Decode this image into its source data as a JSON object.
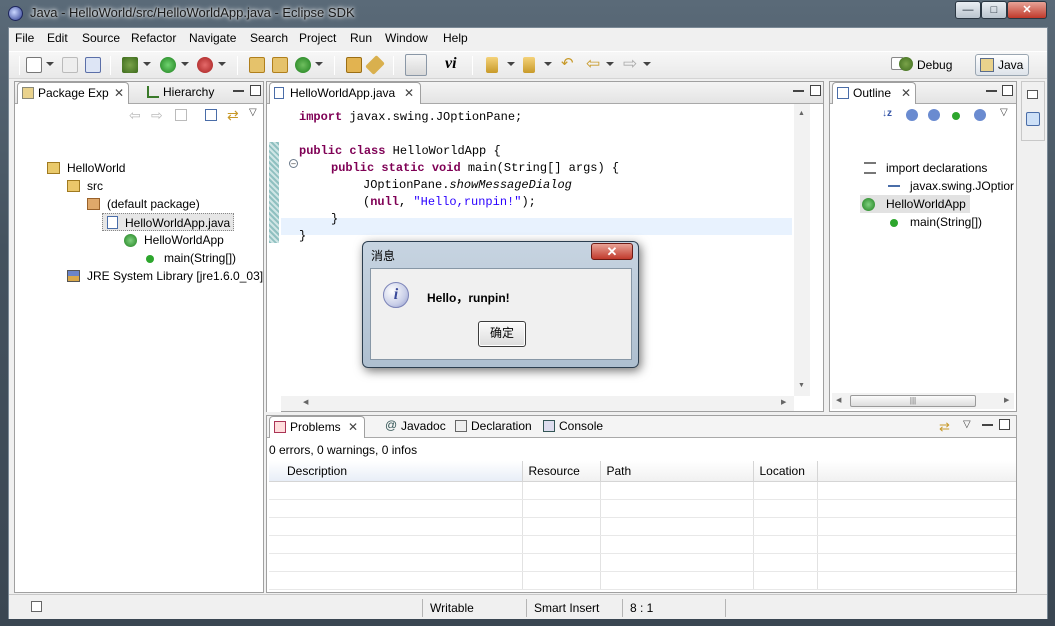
{
  "window": {
    "title": "Java - HelloWorld/src/HelloWorldApp.java - Eclipse SDK"
  },
  "menubar": {
    "items": [
      "File",
      "Edit",
      "Source",
      "Refactor",
      "Navigate",
      "Search",
      "Project",
      "Run",
      "Window",
      "Help"
    ]
  },
  "toolbar": {
    "perspectives": {
      "debug": "Debug",
      "java": "Java"
    }
  },
  "package_explorer": {
    "tabs": [
      "Package Exp",
      "Hierarchy"
    ],
    "tree": [
      "HelloWorld",
      "src",
      "(default package)",
      "HelloWorldApp.java",
      "HelloWorldApp",
      "main(String[])",
      "JRE System Library [jre1.6.0_03]"
    ]
  },
  "editor": {
    "tab": "HelloWorldApp.java",
    "code": {
      "line1_kw": "import",
      "line1_rest": " javax.swing.JOptionPane;",
      "line3_kw1": "public",
      "line3_kw2": "class",
      "line3_rest": " HelloWorldApp {",
      "line4_kw1": "public",
      "line4_kw2": "static",
      "line4_kw3": "void",
      "line4_rest": " main(String[] args) {",
      "line5_a": "JOptionPane.",
      "line5_b": "showMessageDialog",
      "line6_a": "(",
      "line6_kw": "null",
      "line6_b": ", ",
      "line6_str": "\"Hello,runpin!\"",
      "line6_c": ");",
      "line7": "}",
      "line8": "}"
    }
  },
  "outline": {
    "tab": "Outline",
    "items": [
      "import declarations",
      "javax.swing.JOptior",
      "HelloWorldApp",
      "main(String[])"
    ]
  },
  "problems": {
    "tabs": [
      "Problems",
      "Javadoc",
      "Declaration",
      "Console"
    ],
    "summary": "0 errors, 0 warnings, 0 infos",
    "columns": [
      "Description",
      "Resource",
      "Path",
      "Location"
    ]
  },
  "statusbar": {
    "mode": "Writable",
    "insert": "Smart Insert",
    "position": "8 : 1"
  },
  "dialog": {
    "title": "消息",
    "message": "Hello，runpin!",
    "ok": "确定"
  },
  "colors": {
    "keyword": "#7f0055",
    "string": "#2a00ff",
    "selection": "#c7daf5"
  }
}
